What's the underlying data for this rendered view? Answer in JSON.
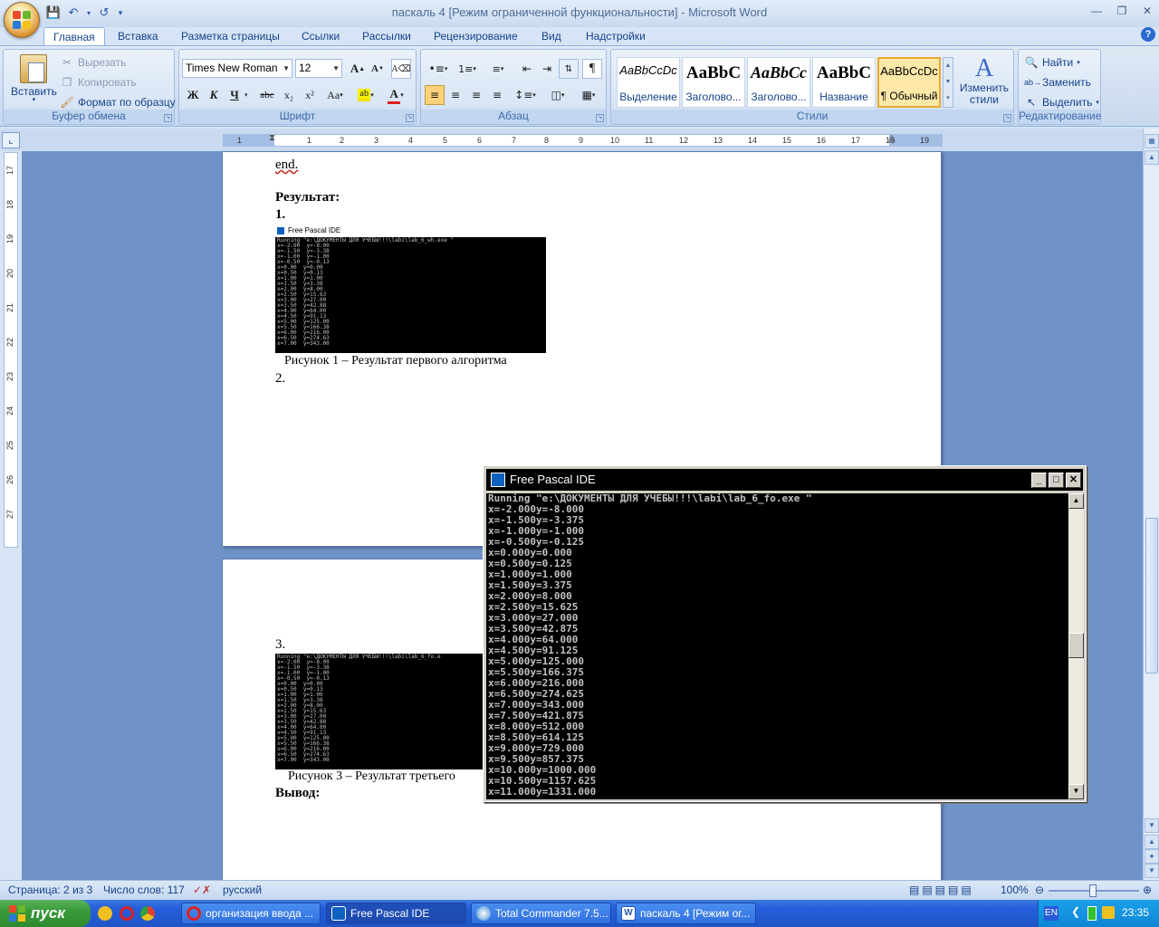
{
  "window": {
    "title": "паскаль 4 [Режим ограниченной функциональности] - Microsoft Word"
  },
  "ribbon": {
    "tabs": [
      "Главная",
      "Вставка",
      "Разметка страницы",
      "Ссылки",
      "Рассылки",
      "Рецензирование",
      "Вид",
      "Надстройки"
    ],
    "clipboard": {
      "paste": "Вставить",
      "cut": "Вырезать",
      "copy": "Копировать",
      "format_painter": "Формат по образцу",
      "title": "Буфер обмена"
    },
    "font": {
      "name": "Times New Roman",
      "size": "12",
      "bold": "Ж",
      "italic": "К",
      "underline": "Ч",
      "strike": "abc",
      "sub": "x₂",
      "sup": "x²",
      "case": "Aa",
      "grow": "A",
      "shrink": "A",
      "title": "Шрифт"
    },
    "paragraph": {
      "title": "Абзац"
    },
    "styles": {
      "items": [
        {
          "sample": "AaBbCcDc",
          "name": "Выделение"
        },
        {
          "sample": "AaBbC",
          "name": "Заголово..."
        },
        {
          "sample": "AaBbCc",
          "name": "Заголово..."
        },
        {
          "sample": "AaBbC",
          "name": "Название"
        },
        {
          "sample": "AaBbCcDc",
          "name": "¶ Обычный"
        }
      ],
      "change": "Изменить стили",
      "title": "Стили"
    },
    "editing": {
      "find": "Найти",
      "replace": "Заменить",
      "select": "Выделить",
      "title": "Редактирование"
    }
  },
  "ruler": {
    "h_ticks": [
      "1",
      "1",
      "2",
      "3",
      "4",
      "5",
      "6",
      "7",
      "8",
      "9",
      "10",
      "11",
      "12",
      "13",
      "14",
      "15",
      "16",
      "17",
      "18",
      "19"
    ],
    "v_ticks": [
      "17",
      "18",
      "19",
      "20",
      "21",
      "22",
      "23",
      "24",
      "25",
      "26",
      "27"
    ]
  },
  "document": {
    "end": "end.",
    "result_heading": "Результат:",
    "item1": "1.",
    "caption1": "Рисунок 1 – Результат первого алгоритма",
    "item2": "2.",
    "item3": "3.",
    "caption3": "Рисунок 3 – Результат третьего",
    "conclusion": "Вывод:",
    "shot1_title": "Free Pascal IDE",
    "shot1_lines": [
      "Running \"e:\\ДОКУМЕНТЫ ДЛЯ УЧЕБЫ!!!\\labi\\lab_6_wh.exe \"",
      "x=-2.00  y=-8.00",
      "x=-1.50  y=-3.38",
      "x=-1.00  y=-1.00",
      "x=-0.50  y=-0.13",
      "x=0.00  y=0.00",
      "x=0.50  y=0.13",
      "x=1.00  y=1.00",
      "x=1.50  y=3.38",
      "x=2.00  y=8.00",
      "x=2.50  y=15.63",
      "x=3.00  y=27.00",
      "x=3.50  y=42.88",
      "x=4.00  y=64.00",
      "x=4.50  y=91.13",
      "x=5.00  y=125.00",
      "x=5.50  y=166.38",
      "x=6.00  y=216.00",
      "x=6.50  y=274.63",
      "x=7.00  y=343.00"
    ],
    "shot3_lines": [
      "Running \"e:\\ДОКУМЕНТЫ ДЛЯ УЧЕБЫ!!!\\labi\\lab_6_fo.e",
      "x=-2.00  y=-8.00",
      "x=-1.50  y=-3.38",
      "x=-1.00  y=-1.00",
      "x=-0.50  y=-0.13",
      "x=0.00  y=0.00",
      "x=0.50  y=0.13",
      "x=1.00  y=1.00",
      "x=1.50  y=3.38",
      "x=2.00  y=8.00",
      "x=2.50  y=15.63",
      "x=3.00  y=27.00",
      "x=3.50  y=42.88",
      "x=4.00  y=64.00",
      "x=4.50  y=91.13",
      "x=5.00  y=125.00",
      "x=5.50  y=166.38",
      "x=6.00  y=216.00",
      "x=6.50  y=274.63",
      "x=7.00  y=343.00"
    ]
  },
  "fp_window": {
    "title": "Free Pascal IDE",
    "lines": [
      "Running \"e:\\ДОКУМЕНТЫ ДЛЯ УЧЕБЫ!!!\\labi\\lab_6_fo.exe \"",
      "x=-2.000y=-8.000",
      "x=-1.500y=-3.375",
      "x=-1.000y=-1.000",
      "x=-0.500y=-0.125",
      "x=0.000y=0.000",
      "x=0.500y=0.125",
      "x=1.000y=1.000",
      "x=1.500y=3.375",
      "x=2.000y=8.000",
      "x=2.500y=15.625",
      "x=3.000y=27.000",
      "x=3.500y=42.875",
      "x=4.000y=64.000",
      "x=4.500y=91.125",
      "x=5.000y=125.000",
      "x=5.500y=166.375",
      "x=6.000y=216.000",
      "x=6.500y=274.625",
      "x=7.000y=343.000",
      "x=7.500y=421.875",
      "x=8.000y=512.000",
      "x=8.500y=614.125",
      "x=9.000y=729.000",
      "x=9.500y=857.375",
      "x=10.000y=1000.000",
      "x=10.500y=1157.625",
      "x=11.000y=1331.000"
    ]
  },
  "status": {
    "page": "Страница: 2 из 3",
    "words": "Число слов: 117",
    "lang": "русский",
    "zoom": "100%"
  },
  "taskbar": {
    "start": "пуск",
    "tasks": [
      "организация ввода ...",
      "Free Pascal IDE",
      "Total Commander 7.5...",
      "паскаль 4 [Режим ог..."
    ],
    "lang": "EN",
    "clock": "23:35"
  },
  "colors": {
    "ribbon_text": "#15428b",
    "workspace": "#6f93c8",
    "taskbar": "#245edb"
  }
}
